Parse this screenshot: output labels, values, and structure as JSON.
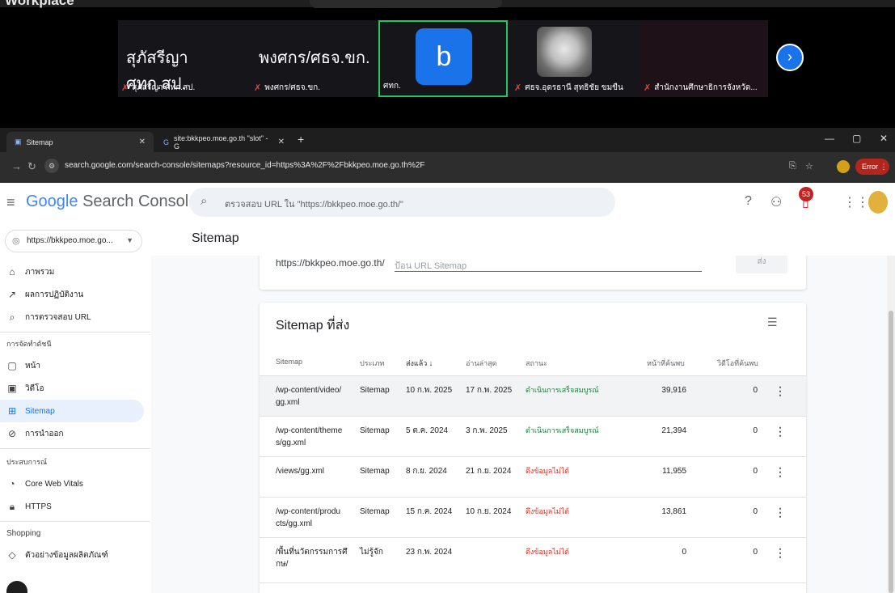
{
  "meet": {
    "title": "Workplace",
    "big_names": [
      "สุภัสรีญา ศทก.สป.",
      "พงศกร/ศธจ.ขก."
    ],
    "tiles": [
      "สุภัสรีญา ศทก.สป.",
      "พงศกร/ศธจ.ขก.",
      "ศทก.",
      "ศธจ.อุดรธานี สุทธิชัย ขมขืน",
      "สำนักงานศึกษาธิการจังหวัด..."
    ],
    "active_avatar": "b"
  },
  "browser": {
    "tab_active": "Sitemap",
    "tab_other": "site:bkkpeo.moe.go.th \"slot\" - G",
    "url": "search.google.com/search-console/sitemaps?resource_id=https%3A%2F%2Fbkkpeo.moe.go.th%2F",
    "error_label": "Error"
  },
  "gsc": {
    "logo_google": "Google",
    "logo_product": "Search Console",
    "search_placeholder": "ตรวจสอบ URL ใน \"https://bkkpeo.moe.go.th/\"",
    "notif_count": "53",
    "property": "https://bkkpeo.moe.go...",
    "page_title": "Sitemap"
  },
  "sidebar": {
    "overview": "ภาพรวม",
    "performance": "ผลการปฏิบัติงาน",
    "url_inspect": "การตรวจสอบ URL",
    "indexing_head": "การจัดทำดัชนี",
    "pages": "หน้า",
    "videos": "วิดีโอ",
    "sitemap": "Sitemap",
    "removals": "การนำออก",
    "experience_head": "ประสบการณ์",
    "cwv": "Core Web Vitals",
    "https": "HTTPS",
    "shopping_head": "Shopping",
    "product_snippets": "ตัวอย่างข้อมูลผลิตภัณฑ์"
  },
  "add_sitemap": {
    "prefix": "https://bkkpeo.moe.go.th/",
    "placeholder": "ป้อน URL Sitemap",
    "submit": "ส่ง"
  },
  "table": {
    "title": "Sitemap ที่ส่ง",
    "headers": [
      "Sitemap",
      "ประเภท",
      "ส่งแล้ว",
      "อ่านล่าสุด",
      "สถานะ",
      "หน้าที่ค้นพบ",
      "วิดีโอที่ค้นพบ"
    ],
    "rows": [
      {
        "path": "/wp-content/video/gg.xml",
        "path_l1": "/wp-content/video/",
        "path_l2": "gg.xml",
        "type": "Sitemap",
        "submitted": "10 ก.พ. 2025",
        "last_read": "17 ก.พ. 2025",
        "status": "ดำเนินการเสร็จสมบูรณ์",
        "pages": "39,916",
        "videos": "0"
      },
      {
        "path": "/wp-content/themes/gg.xml",
        "path_l1": "/wp-content/theme",
        "path_l2": "s/gg.xml",
        "type": "Sitemap",
        "submitted": "5 ต.ค. 2024",
        "last_read": "3 ก.พ. 2025",
        "status": "ดำเนินการเสร็จสมบูรณ์",
        "pages": "21,394",
        "videos": "0"
      },
      {
        "path": "/views/gg.xml",
        "path_l1": "/views/gg.xml",
        "path_l2": "",
        "type": "Sitemap",
        "submitted": "8 ก.ย. 2024",
        "last_read": "21 ก.ย. 2024",
        "status": "ดึงข้อมูลไม่ได้",
        "pages": "11,955",
        "videos": "0"
      },
      {
        "path": "/wp-content/products/gg.xml",
        "path_l1": "/wp-content/produ",
        "path_l2": "cts/gg.xml",
        "type": "Sitemap",
        "submitted": "15 ก.ค. 2024",
        "last_read": "10 ก.ย. 2024",
        "status": "ดึงข้อมูลไม่ได้",
        "pages": "13,861",
        "videos": "0"
      },
      {
        "path": "/พื้นที่นวัตกรรมการศึกษา/",
        "path_l1": "/พื้นที่นวัตกรรมการศึ",
        "path_l2": "กษ/",
        "type": "ไม่รู้จัก",
        "submitted": "23 ก.พ. 2024",
        "last_read": "",
        "status": "ดึงข้อมูลไม่ได้",
        "pages": "0",
        "videos": "0"
      }
    ]
  },
  "colors": {
    "ok": "#188038",
    "err": "#d93025",
    "accent": "#1a73e8"
  }
}
